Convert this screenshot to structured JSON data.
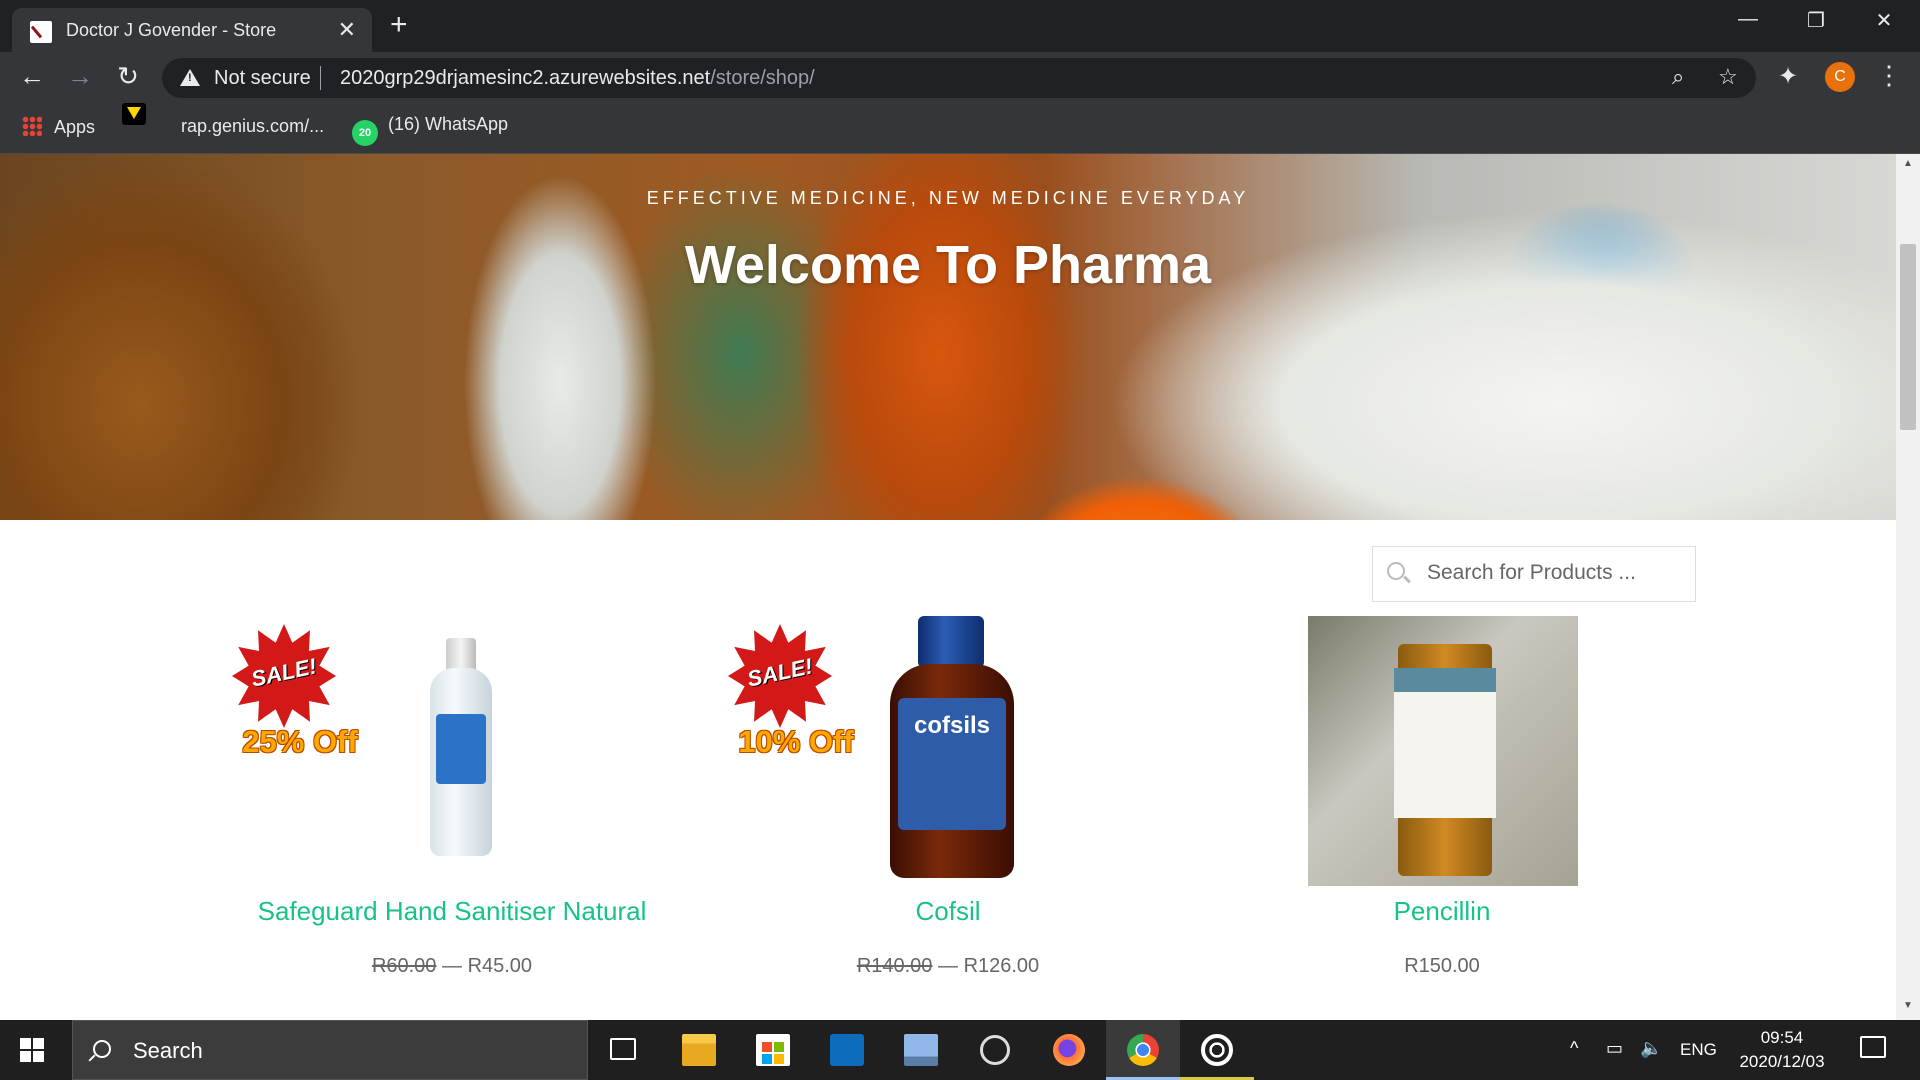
{
  "browser": {
    "tab_title": "Doctor J Govender - Store",
    "tab_close": "✕",
    "new_tab": "+",
    "window_controls": {
      "minimize": "—",
      "restore": "❐",
      "close": "✕"
    },
    "nav": {
      "back": "←",
      "forward": "→",
      "reload": "↻"
    },
    "security_label": "Not secure",
    "url_host": "2020grp29drjamesinc2.azurewebsites.net",
    "url_path": "/store/shop/",
    "zoom_icon": "⌕",
    "star_icon": "☆",
    "extensions_icon": "✦",
    "profile_initial": "C",
    "menu_icon": "⋮",
    "bookmarks": {
      "apps": "Apps",
      "genius": "rap.genius.com/...",
      "whatsapp_badge": "20",
      "whatsapp": "(16) WhatsApp"
    }
  },
  "page": {
    "hero": {
      "eyebrow": "EFFECTIVE MEDICINE, NEW MEDICINE EVERYDAY",
      "title": "Welcome To Pharma"
    },
    "search": {
      "placeholder": "Search for Products ..."
    },
    "products": [
      {
        "name": "Safeguard Hand Sanitiser Natural",
        "old_price": "R60.00",
        "separator": "—",
        "price": "R45.00",
        "sale_badge": "SALE!",
        "discount": "25% Off"
      },
      {
        "name": "Cofsil",
        "old_price": "R140.00",
        "separator": "—",
        "price": "R126.00",
        "sale_badge": "SALE!",
        "discount": "10% Off",
        "brand": "cofsils"
      },
      {
        "name": "Pencillin",
        "price": "R150.00"
      }
    ]
  },
  "taskbar": {
    "search_text": "Search",
    "language": "ENG",
    "time": "09:54",
    "date": "2020/12/03",
    "tray_up": "^",
    "tray_network": "▭",
    "tray_volume": "🔈"
  },
  "colors": {
    "accent_green": "#17c28a",
    "chrome_dark": "#202124",
    "chrome_toolbar": "#35363a",
    "sale_red": "#d31818",
    "discount_orange": "#ffa600"
  }
}
